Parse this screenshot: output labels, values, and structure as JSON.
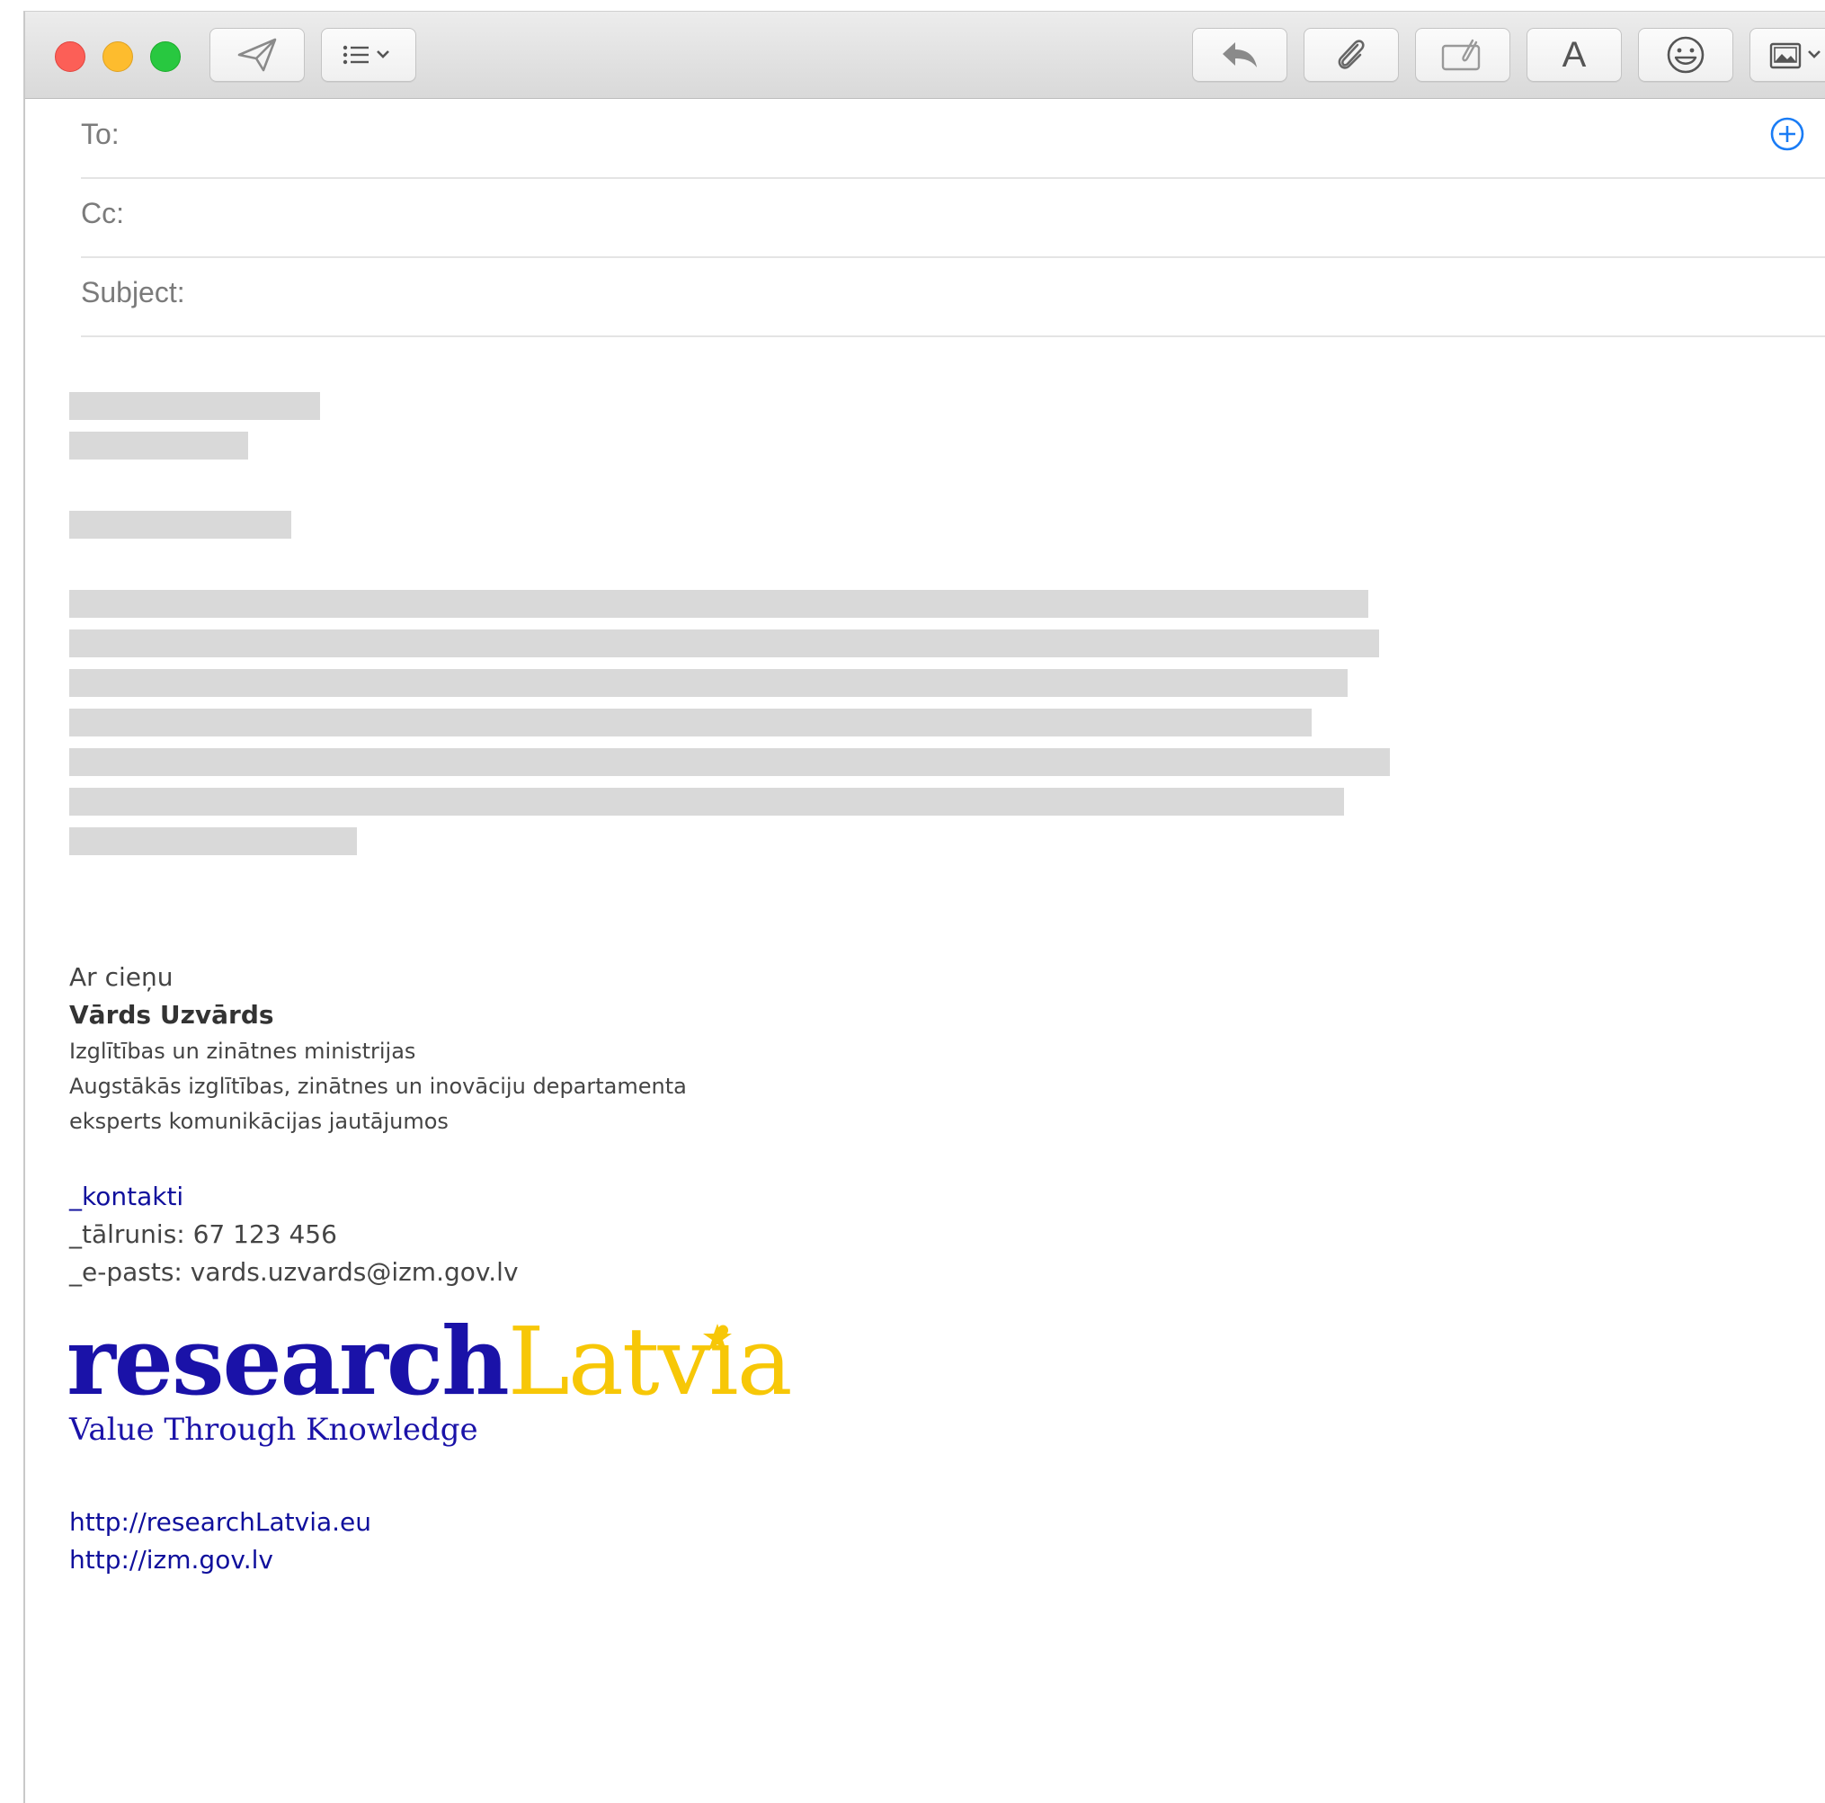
{
  "compose": {
    "to_label": "To:",
    "cc_label": "Cc:",
    "subject_label": "Subject:"
  },
  "toolbar": {
    "format_letter": "A"
  },
  "colors": {
    "close": "#fc5f57",
    "minimize": "#fdbc2e",
    "zoom": "#28c840",
    "accent_blue": "#1a7cf5",
    "brand_blue": "#1a12a8",
    "brand_yellow": "#f7c707",
    "link_blue": "#0f0f9c"
  },
  "icons": [
    "send-icon",
    "list-icon",
    "reply-icon",
    "attachment-icon",
    "markup-icon",
    "format-icon",
    "emoji-icon",
    "photo-browser-icon",
    "add-contact-icon"
  ],
  "signature": {
    "greeting": "Ar cieņu",
    "name": "Vārds Uzvārds",
    "ministry": "Izglītības un zinātnes ministrijas",
    "department": "Augstākās izglītības, zinātnes un inovāciju departamenta",
    "position": "eksperts komunikācijas jautājumos",
    "contacts_heading": "_kontakti",
    "phone": "_tālrunis: 67 123 456",
    "email": "_e-pasts: vards.uzvards@izm.gov.lv",
    "logo_research": "research",
    "logo_latvia": "Latvia",
    "tagline": "Value Through Knowledge",
    "link1": "http://researchLatvia.eu",
    "link2": "http://izm.gov.lv"
  }
}
